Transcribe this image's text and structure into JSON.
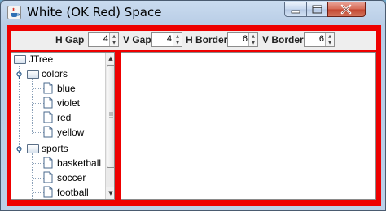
{
  "window": {
    "title": "White (OK Red) Space",
    "app_icon": "java-coffee-cup-icon",
    "controls": {
      "minimize": "minimize-icon",
      "maximize": "maximize-icon",
      "close": "close-icon"
    }
  },
  "toolbar": {
    "h_gap_label": "H Gap",
    "h_gap_value": "4",
    "v_gap_label": "V Gap",
    "v_gap_value": "4",
    "h_border_label": "H Border",
    "h_border_value": "6",
    "v_border_label": "V Border",
    "v_border_value": "6"
  },
  "tree": {
    "root": "JTree",
    "colors": {
      "label": "colors",
      "children": [
        "blue",
        "violet",
        "red",
        "yellow"
      ]
    },
    "sports": {
      "label": "sports",
      "children": [
        "basketball",
        "soccer",
        "football"
      ]
    }
  },
  "colors": {
    "border_red": "#ee0000",
    "panel_bg": "#ffffff",
    "toolbar_bg": "#eeeeee"
  }
}
